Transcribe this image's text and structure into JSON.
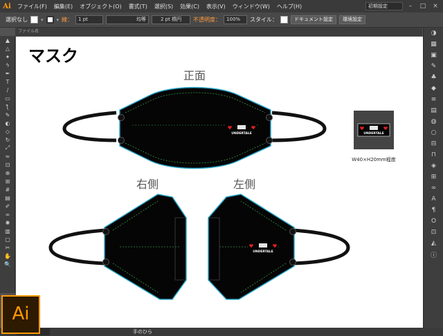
{
  "app": {
    "logo": "Ai",
    "badge": "Ai"
  },
  "menubar": {
    "items": [
      "ファイル(F)",
      "編集(E)",
      "オブジェクト(O)",
      "書式(T)",
      "選択(S)",
      "効果(C)",
      "表示(V)",
      "ウィンドウ(W)",
      "ヘルプ(H)"
    ],
    "workspace": "初期設定",
    "minimize": "–",
    "restore": "□",
    "close": "×"
  },
  "controlbar": {
    "selection": "選択なし",
    "stroke_label": "線：",
    "stroke_weight": "1 pt",
    "stroke_profile": "均等",
    "brush": "2 pt 楕円",
    "opacity_label": "不透明度：",
    "opacity_value": "100%",
    "style_label": "スタイル：",
    "doc_setup_button": "ドキュメント設定",
    "prefs_button": "環境設定"
  },
  "doc_tab": "ファイル名",
  "artboard": {
    "title": "マスク",
    "front_label": "正面",
    "right_label": "右側",
    "left_label": "左側",
    "logo_text": "UNDERTALE",
    "logo_subtitle": "UNDERTALE",
    "size_note": "W40×H20mm程度"
  },
  "toolbox": {
    "icons": [
      "selection-tool-icon",
      "direct-selection-tool-icon",
      "magic-wand-icon",
      "lasso-icon",
      "pen-tool-icon",
      "type-tool-icon",
      "line-tool-icon",
      "rectangle-tool-icon",
      "paintbrush-icon",
      "pencil-icon",
      "blob-brush-icon",
      "eraser-icon",
      "rotate-tool-icon",
      "scale-tool-icon",
      "width-tool-icon",
      "free-transform-icon",
      "shape-builder-icon",
      "perspective-grid-icon",
      "mesh-tool-icon",
      "gradient-tool-icon",
      "eyedropper-icon",
      "blend-tool-icon",
      "symbol-sprayer-icon",
      "column-graph-icon",
      "artboard-tool-icon",
      "slice-tool-icon",
      "hand-tool-icon",
      "zoom-tool-icon"
    ],
    "glyphs": [
      "▲",
      "△",
      "✦",
      "ϟ",
      "✒",
      "T",
      "/",
      "▭",
      "ƪ",
      "✎",
      "◐",
      "◇",
      "↻",
      "⤢",
      "≈",
      "⊡",
      "⊕",
      "⊞",
      "#",
      "▤",
      "✐",
      "∞",
      "✺",
      "▥",
      "▢",
      "✂",
      "✋",
      "🔍"
    ]
  },
  "right_dock": {
    "icons": [
      "color-panel-icon",
      "color-guide-icon",
      "swatches-icon",
      "brushes-icon",
      "symbols-icon",
      "graphic-styles-icon",
      "stroke-panel-icon",
      "gradient-panel-icon",
      "transparency-icon",
      "appearance-icon",
      "align-icon",
      "pathfinder-icon",
      "layers-icon",
      "artboards-icon",
      "links-icon",
      "character-icon",
      "paragraph-icon",
      "opentype-icon",
      "transform-icon",
      "navigator-icon",
      "info-icon"
    ],
    "glyphs": [
      "◑",
      "▦",
      "▣",
      "✎",
      "♣",
      "◆",
      "≡",
      "▤",
      "◍",
      "○",
      "⊟",
      "⊓",
      "◈",
      "⊞",
      "∞",
      "A",
      "¶",
      "O",
      "⊡",
      "◭",
      "ⓘ"
    ]
  },
  "statusbar": {
    "zoom": "",
    "tool": "手のひら"
  },
  "colors": {
    "mask_fill": "#050505",
    "mask_outline": "#2aa7c9",
    "stitch": "#3a9a4a",
    "heart": "#e32020",
    "ear_loop": "#111111"
  }
}
